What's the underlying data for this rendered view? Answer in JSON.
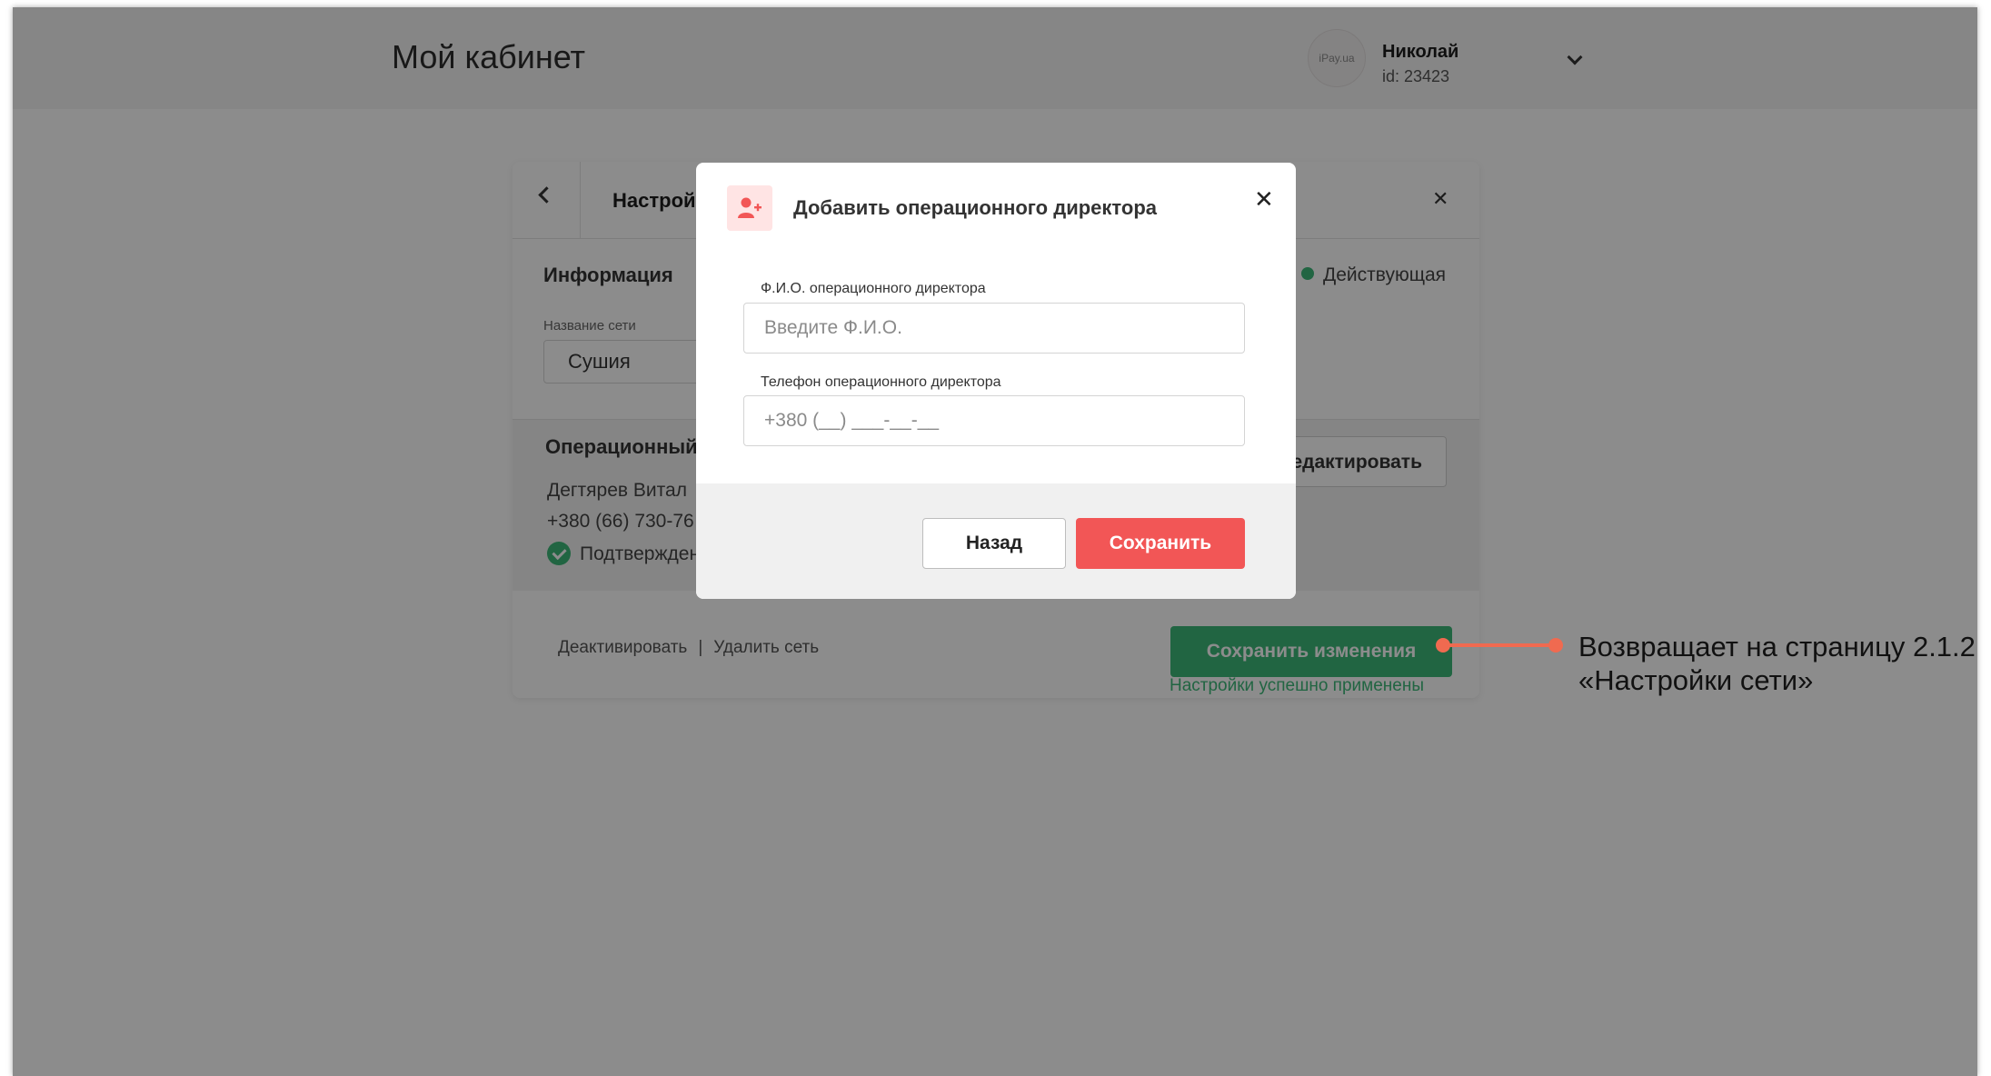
{
  "header": {
    "page_title": "Мой кабинет",
    "avatar_text": "iPay.ua",
    "user_name": "Николай",
    "user_id": "id: 23423"
  },
  "card": {
    "title": "Настрой",
    "info_title": "Информация",
    "status": "Действующая",
    "network_name_label": "Название сети",
    "network_name_value": "Сушия",
    "operational_title": "Операционный",
    "operational_name": "Дегтярев Витал",
    "operational_phone": "+380 (66) 730-76",
    "operational_confirmed": "Подтвержден",
    "edit_button": "едактировать",
    "deactivate_link": "Деактивировать",
    "separator": "|",
    "delete_link": "Удалить сеть",
    "save_changes_button": "Сохранить изменения",
    "success_text": "Настройки успешно применены"
  },
  "modal": {
    "title": "Добавить операционного директора",
    "name_label": "Ф.И.О. операционного директора",
    "name_placeholder": "Введите Ф.И.О.",
    "phone_label": "Телефон операционного директора",
    "phone_placeholder": "+380 (__) ___-__-__",
    "back_button": "Назад",
    "save_button": "Сохранить"
  },
  "annotation": {
    "line1": "Возвращает на страницу 2.1.2",
    "line2": "«Настройки сети»"
  },
  "colors": {
    "accent_red": "#f25656",
    "accent_green": "#3cb878",
    "annotation_orange": "#f06a50"
  },
  "icons": {
    "modal_icon": "add-user-icon",
    "close": "close-icon",
    "back": "chevron-left-icon",
    "user_menu": "chevron-down-icon",
    "confirmed": "check-circle-icon"
  }
}
